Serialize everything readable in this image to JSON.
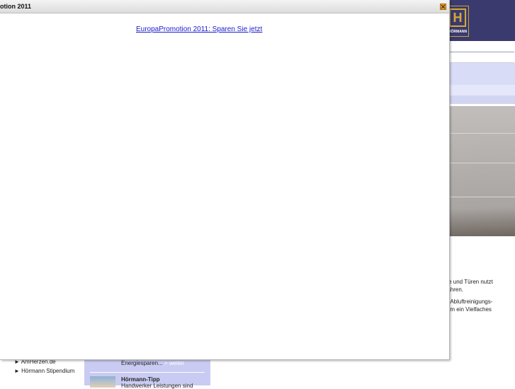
{
  "modal": {
    "title": "otion 2011",
    "link_text": "EuropaPromotion 2011: Sparen Sie jetzt"
  },
  "background": {
    "logo_text": "HÖRMANN",
    "logo_mark": "H",
    "body_lines": [
      "Tore und Türen nutzt",
      "erfahren.",
      "ren Abluftreinigungs-",
      "uf um ein Vielfaches"
    ],
    "left_nav": [
      "► AmHerzen.de",
      "► Hörmann Stipendium"
    ],
    "teaser": {
      "text": "Energiesparen...",
      "more": "> weiter",
      "tip_title": "Hörmann-Tipp",
      "tip_text": "Handwerker Leistungen sind"
    }
  },
  "colors": {
    "header": "#3a3a6e",
    "link": "#1a1acc",
    "close_button": "#e8a63a"
  }
}
